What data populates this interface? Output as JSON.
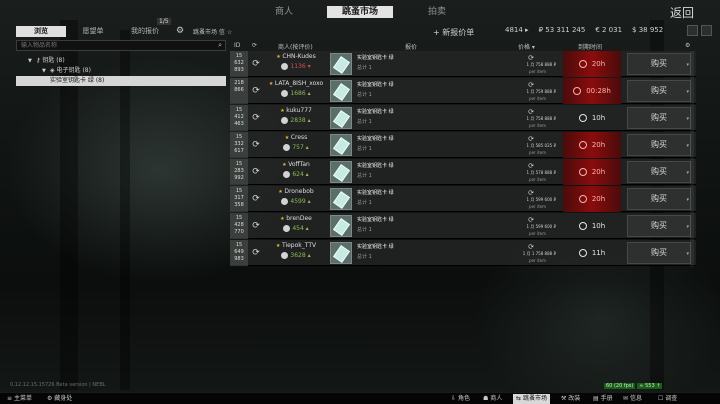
{
  "top_tabs": {
    "traders": "商人",
    "flea": "跳蚤市场",
    "auction": "拍卖",
    "back": "返回"
  },
  "sub_tabs": {
    "browse": "浏览",
    "wishlist": "愿望单",
    "my_offers": "我的报价",
    "offers_badge": "1/5",
    "rating": "跳蚤市场 信 ☆"
  },
  "add_offer": "+ 新报价单",
  "balances": {
    "count": "4814 ▸",
    "roubles": "₽ 53 311 245",
    "euros": "€ 2 031",
    "dollars": "$ 38 952"
  },
  "search": {
    "placeholder": "输入物品名称"
  },
  "tree": {
    "l0": "钥匙 (8)",
    "l1": "电子钥匙 (8)",
    "l2": "实验室钥匙卡 绿 (8)"
  },
  "table_header": {
    "id": "ID",
    "seller": "商人(按评价)",
    "desc": "报价",
    "price": "价格 ▾",
    "time": "到期时间"
  },
  "rows": [
    {
      "id1": "15",
      "id2": "632",
      "id3": "893",
      "seller": "CHN-Kudes",
      "rating": "1136 ▾",
      "rating_color": "red",
      "desc": "实验室钥匙卡 绿",
      "desc_sub": "总计 1",
      "price": "1 月 758 888 ₽",
      "unit": "per item",
      "time": "20h",
      "time_style": "red",
      "buy": "购买"
    },
    {
      "id1": "218",
      "id2": "866",
      "id3": "",
      "seller": "LATA_8ISH_xoxo",
      "rating": "1686 ▴",
      "rating_color": "green",
      "desc": "实验室钥匙卡 绿",
      "desc_sub": "总计 1",
      "price": "1 月 759 888 ₽",
      "unit": "per item",
      "time": "00:28h",
      "time_style": "red",
      "buy": "购买"
    },
    {
      "id1": "15",
      "id2": "412",
      "id3": "463",
      "seller": "kuku777",
      "rating": "2838 ▴",
      "rating_color": "green",
      "desc": "实验室钥匙卡 绿",
      "desc_sub": "总计 1",
      "price": "1 月 758 888 ₽",
      "unit": "per item",
      "time": "10h",
      "time_style": "gray",
      "buy": "购买"
    },
    {
      "id1": "15",
      "id2": "332",
      "id3": "617",
      "seller": "Cress",
      "rating": "757 ▴",
      "rating_color": "green",
      "desc": "实验室钥匙卡 绿",
      "desc_sub": "总计 1",
      "price": "1 月 585 025 ₽",
      "unit": "per item",
      "time": "20h",
      "time_style": "red",
      "buy": "购买"
    },
    {
      "id1": "15",
      "id2": "283",
      "id3": "992",
      "seller": "VoffTan",
      "rating": "624 ▴",
      "rating_color": "green",
      "desc": "实验室钥匙卡 绿",
      "desc_sub": "总计 1",
      "price": "1 月 578 888 ₽",
      "unit": "per item",
      "time": "20h",
      "time_style": "red",
      "buy": "购买"
    },
    {
      "id1": "15",
      "id2": "317",
      "id3": "358",
      "seller": "Dronebob",
      "rating": "4599 ▴",
      "rating_color": "green",
      "desc": "实验室钥匙卡 绿",
      "desc_sub": "总计 1",
      "price": "1 月 599 600 ₽",
      "unit": "per item",
      "time": "20h",
      "time_style": "red",
      "buy": "购买"
    },
    {
      "id1": "15",
      "id2": "428",
      "id3": "770",
      "seller": "brenDee",
      "rating": "454 ▴",
      "rating_color": "green",
      "desc": "实验室钥匙卡 绿",
      "desc_sub": "总计 1",
      "price": "1 月 599 600 ₽",
      "unit": "per item",
      "time": "10h",
      "time_style": "gray",
      "buy": "购买"
    },
    {
      "id1": "15",
      "id2": "649",
      "id3": "983",
      "seller": "Tiepok_TTV",
      "rating": "3628 ▴",
      "rating_color": "green",
      "desc": "实验室钥匙卡 绿",
      "desc_sub": "总计 1",
      "price": "1 月 1 758 888 ₽",
      "unit": "per item",
      "time": "11h",
      "time_style": "gray",
      "buy": "购买"
    }
  ],
  "version": "0.12.12.15.15726 Beta version | NEBL",
  "perf": [
    "60 (20 fps)",
    "≈ 553 ↑"
  ],
  "bottom_bar": {
    "main_menu": "主菜单",
    "settings": "藏身处",
    "char": "角色",
    "traders": "商人",
    "flea": "跳蚤市场",
    "build": "改装",
    "handbook": "手册",
    "messenger": "信息",
    "survey": "调查"
  }
}
